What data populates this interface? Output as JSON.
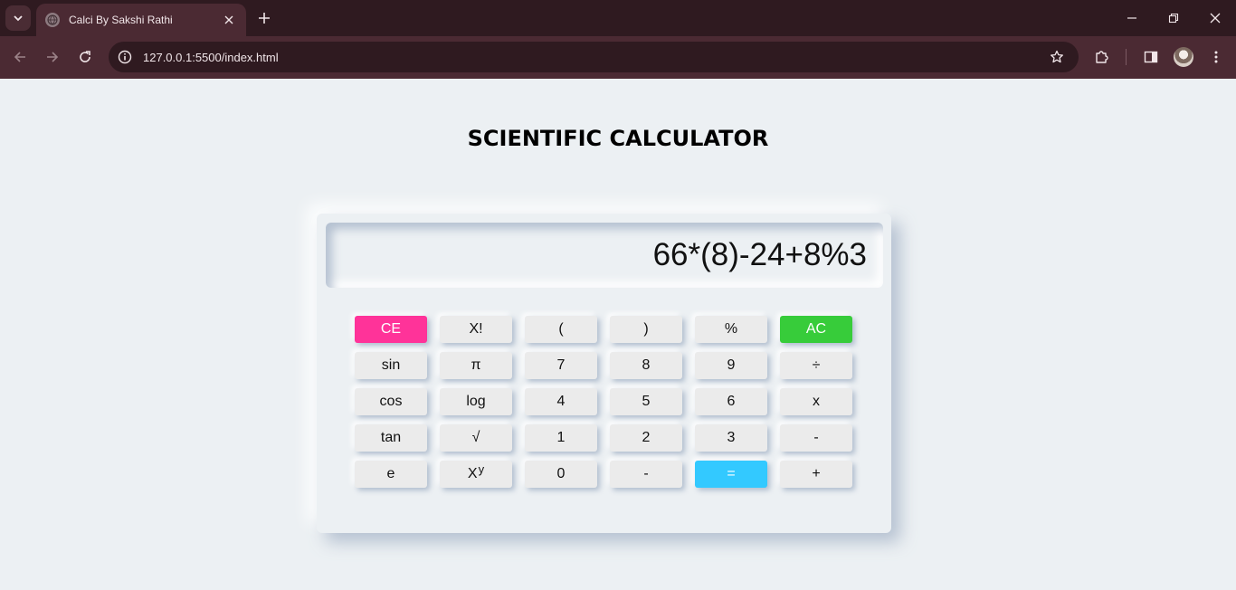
{
  "browser": {
    "tab_title": "Calci By Sakshi Rathi",
    "url": "127.0.0.1:5500/index.html"
  },
  "page": {
    "heading": "SCIENTIFIC CALCULATOR",
    "display_value": "66*(8)-24+8%3"
  },
  "buttons": {
    "ce": "CE",
    "fact": "X!",
    "lparen": "(",
    "rparen": ")",
    "percent": "%",
    "ac": "AC",
    "sin": "sin",
    "pi": "π",
    "seven": "7",
    "eight": "8",
    "nine": "9",
    "divide": "÷",
    "cos": "cos",
    "log": "log",
    "four": "4",
    "five": "5",
    "six": "6",
    "multiply": "x",
    "tan": "tan",
    "sqrt": "√",
    "one": "1",
    "two": "2",
    "three": "3",
    "minus": "-",
    "e": "e",
    "pow_base": "X",
    "pow_exp": "y",
    "zero": "0",
    "minus2": "-",
    "equals": "=",
    "plus": "+"
  },
  "colors": {
    "ce": "#ff3399",
    "ac": "#37cc3a",
    "equals": "#33c9ff",
    "background": "#ecf0f3"
  }
}
